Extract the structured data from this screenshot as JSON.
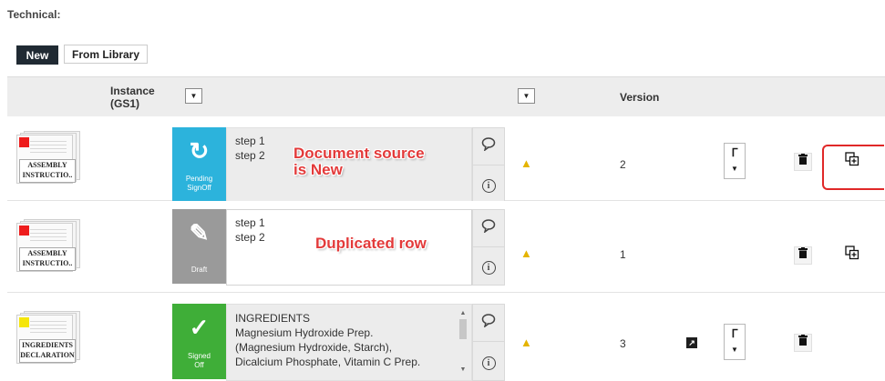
{
  "section": {
    "title": "Technical:"
  },
  "toolbar": {
    "new_label": "New",
    "library_label": "From Library"
  },
  "header": {
    "instance_line1": "Instance",
    "instance_line2": "(GS1)",
    "filter_glyph": "▼",
    "version_label": "Version"
  },
  "rows": [
    {
      "doc_label_line1": "ASSEMBLY",
      "doc_label_line2": "INSTRUCTIO..",
      "flag_color": "#ee1c1c",
      "status_color": "#2cb3dc",
      "status_glyph": "↻",
      "status_line1": "Pending",
      "status_line2": "SignOff",
      "content": [
        "step 1",
        "step 2"
      ],
      "warn_glyph": "▲",
      "version": "2",
      "annotation_line1": "Document source",
      "annotation_line2": "is New"
    },
    {
      "doc_label_line1": "ASSEMBLY",
      "doc_label_line2": "INSTRUCTIO..",
      "flag_color": "#ee1c1c",
      "status_color": "#9a9a9a",
      "status_glyph": "✎",
      "status_line1": "Draft",
      "status_line2": "",
      "content": [
        "step 1",
        "step 2"
      ],
      "warn_glyph": "▲",
      "version": "1",
      "annotation_line1": "Duplicated row"
    },
    {
      "doc_label_line1": "INGREDIENTS",
      "doc_label_line2": "DECLARATION",
      "flag_color": "#f5e60a",
      "status_color": "#3fae38",
      "status_glyph": "✓",
      "status_line1": "Signed",
      "status_line2": "Off",
      "content": [
        "INGREDIENTS",
        "Magnesium Hydroxide Prep.",
        "(Magnesium Hydroxide, Starch),",
        "Dicalcium Phosphate, Vitamin C Prep."
      ],
      "warn_glyph": "▲",
      "version": "3"
    }
  ],
  "icons": {
    "comment": "⌕",
    "info": "i",
    "sync": "ᒥ",
    "caret": "▼",
    "trash": "🗑",
    "duplicate": "⧉",
    "external": "↗"
  }
}
